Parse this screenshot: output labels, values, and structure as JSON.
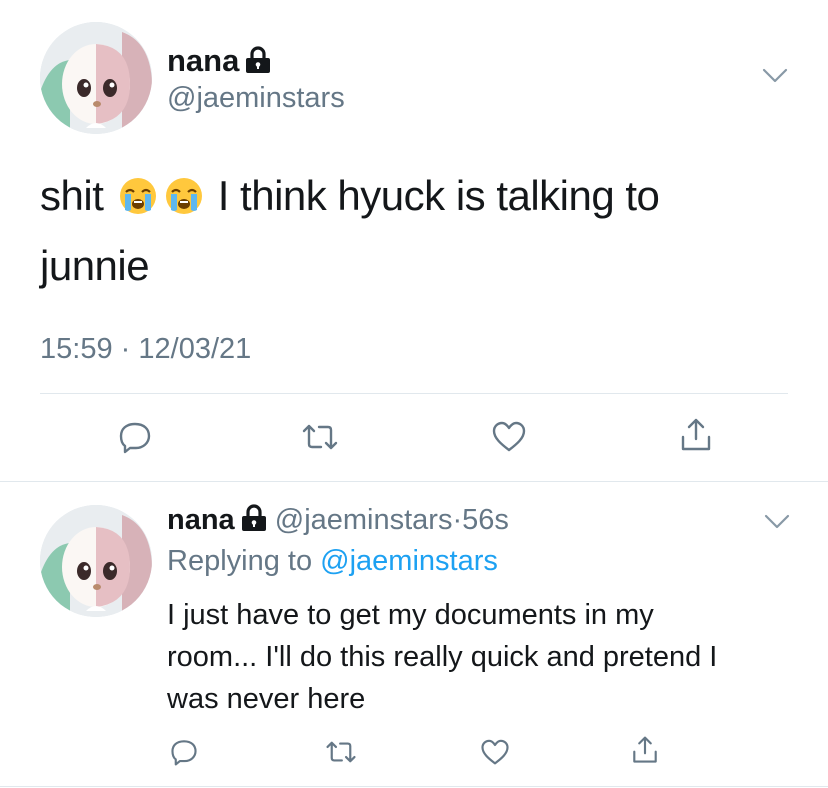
{
  "main_tweet": {
    "display_name": "nana",
    "handle": "@jaeminstars",
    "text_before_emoji": "shit",
    "emoji": [
      "loudly-crying-face",
      "loudly-crying-face"
    ],
    "text_after_emoji": "I think hyuck is talking to",
    "text_line2": "junnie",
    "time": "15:59",
    "separator": "·",
    "date": "12/03/21"
  },
  "reply_tweet": {
    "display_name": "nana",
    "handle": "@jaeminstars",
    "separator": "·",
    "age": "56s",
    "replying_prefix": "Replying to",
    "replying_to": "@jaeminstars",
    "text_line1": "I just have to get my documents in my",
    "text_line2": "room... I'll do this really quick and pretend I",
    "text_line3": "was never here"
  },
  "actions": [
    "reply-icon",
    "retweet-icon",
    "like-icon",
    "share-icon"
  ],
  "colors": {
    "text": "#14171a",
    "secondary": "#657786",
    "link": "#1da1f2",
    "icon": "#657786",
    "divider": "#e1e8ed"
  }
}
